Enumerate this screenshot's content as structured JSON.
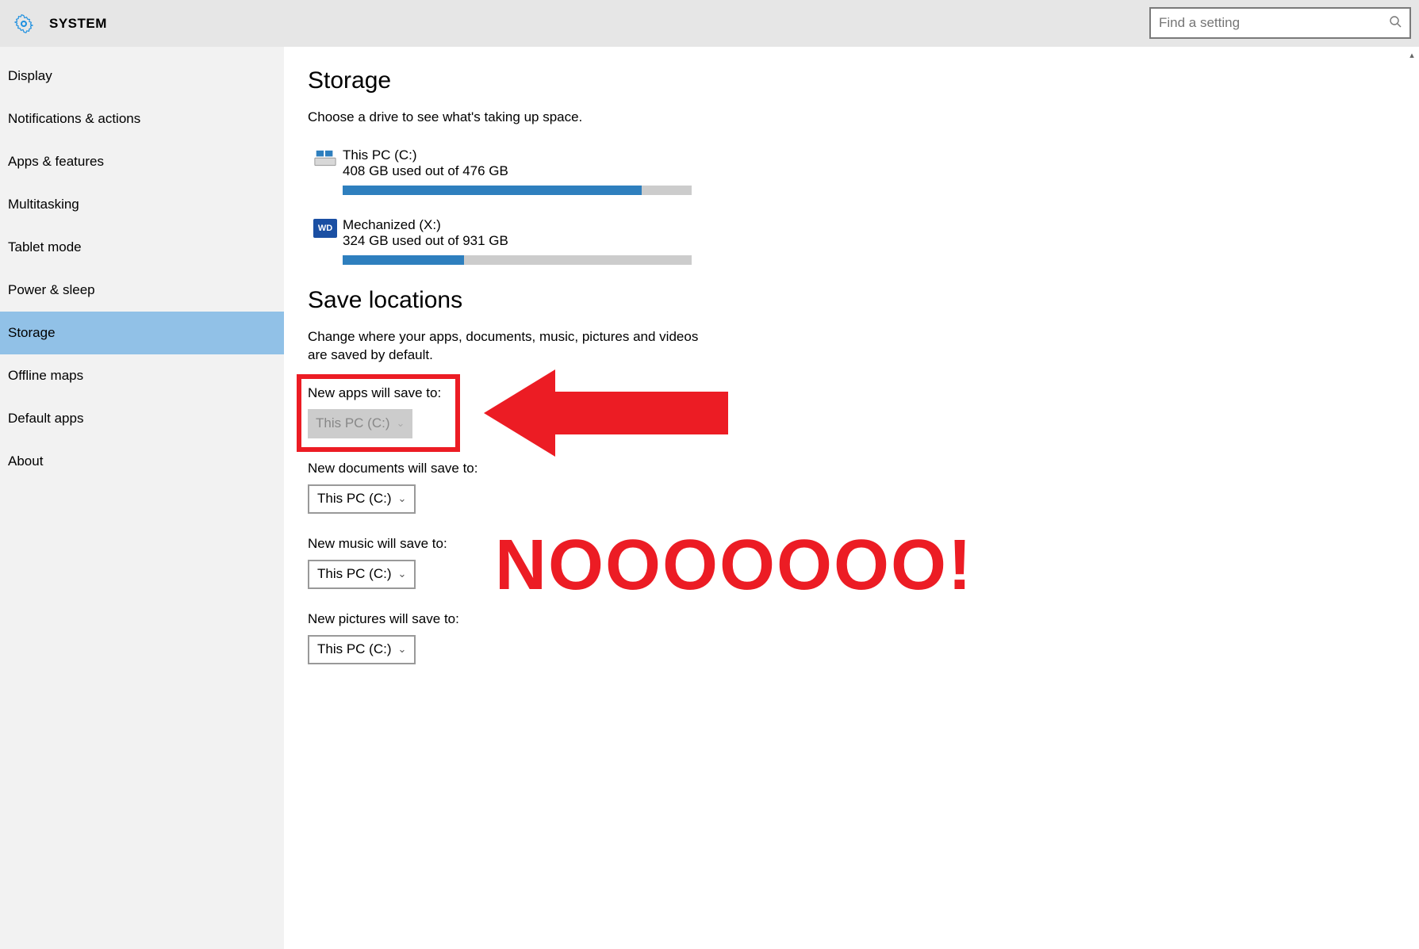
{
  "header": {
    "title": "SYSTEM",
    "search_placeholder": "Find a setting"
  },
  "sidebar": {
    "items": [
      {
        "label": "Display",
        "selected": false
      },
      {
        "label": "Notifications & actions",
        "selected": false
      },
      {
        "label": "Apps & features",
        "selected": false
      },
      {
        "label": "Multitasking",
        "selected": false
      },
      {
        "label": "Tablet mode",
        "selected": false
      },
      {
        "label": "Power & sleep",
        "selected": false
      },
      {
        "label": "Storage",
        "selected": true
      },
      {
        "label": "Offline maps",
        "selected": false
      },
      {
        "label": "Default apps",
        "selected": false
      },
      {
        "label": "About",
        "selected": false
      }
    ]
  },
  "storage": {
    "title": "Storage",
    "description": "Choose a drive to see what's taking up space.",
    "drives": [
      {
        "icon": "windows-drive",
        "name": "This PC (C:)",
        "usage": "408 GB used out of 476 GB",
        "percent": 85.7
      },
      {
        "icon": "wd-drive",
        "name": "Mechanized (X:)",
        "usage": "324 GB used out of 931 GB",
        "percent": 34.8
      }
    ]
  },
  "save_locations": {
    "title": "Save locations",
    "description": "Change where your apps, documents, music, pictures and videos are saved by default.",
    "rows": [
      {
        "label": "New apps will save to:",
        "value": "This PC (C:)",
        "disabled": true
      },
      {
        "label": "New documents will save to:",
        "value": "This PC (C:)",
        "disabled": false
      },
      {
        "label": "New music will save to:",
        "value": "This PC (C:)",
        "disabled": false
      },
      {
        "label": "New pictures will save to:",
        "value": "This PC (C:)",
        "disabled": false
      }
    ]
  },
  "annotation": {
    "exclaim": "NOOOOOOO!"
  },
  "colors": {
    "accent": "#2e7fbe",
    "selected": "#91c1e7",
    "red": "#ec1c24"
  }
}
